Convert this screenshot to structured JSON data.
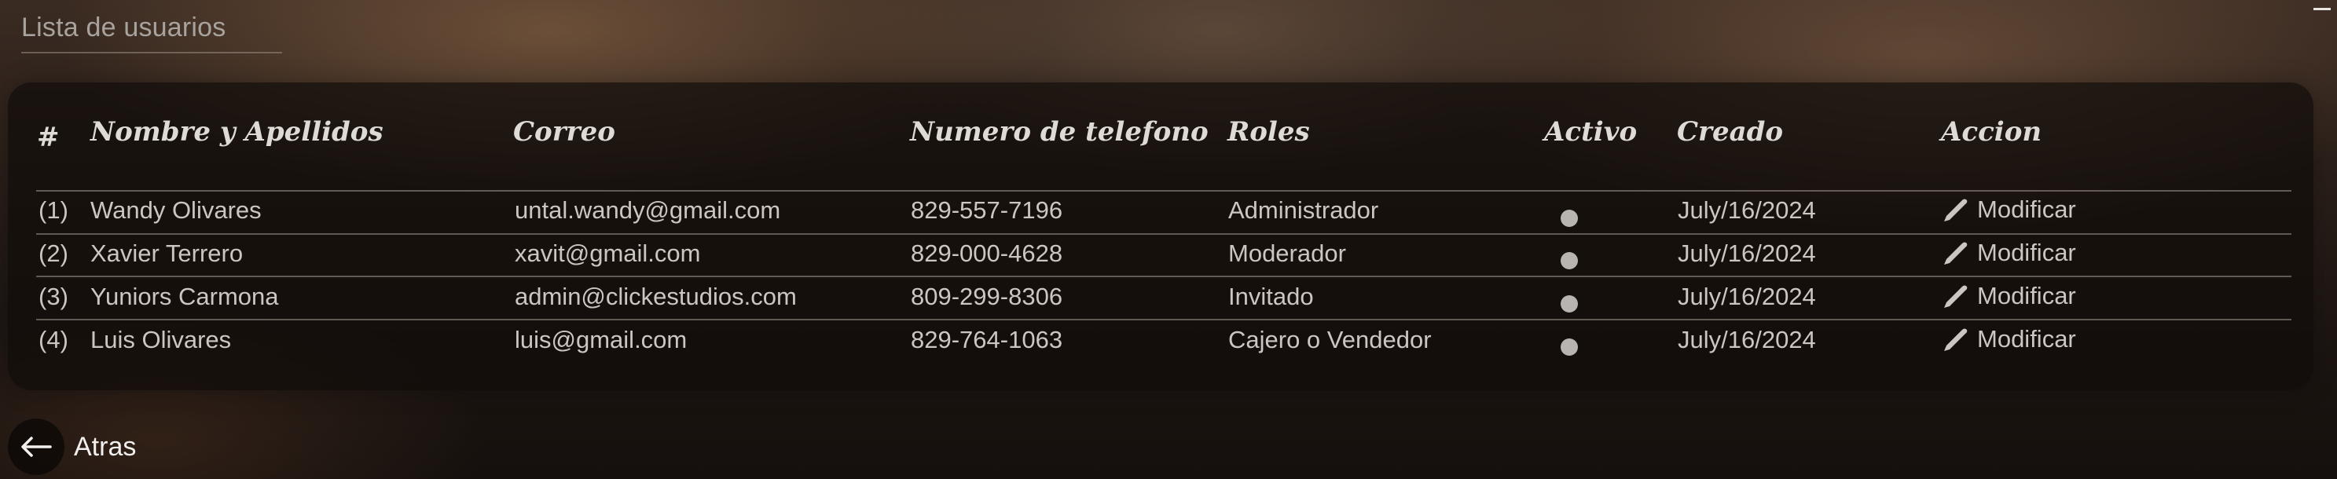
{
  "page": {
    "title": "Lista de usuarios"
  },
  "table": {
    "headers": {
      "index": "#",
      "name": "Nombre y Apellidos",
      "email": "Correo",
      "phone": "Numero de telefono",
      "roles": "Roles",
      "active": "Activo",
      "created": "Creado",
      "action": "Accion"
    },
    "rows": [
      {
        "index": "(1)",
        "name": "Wandy Olivares",
        "email": "untal.wandy@gmail.com",
        "phone": "829-557-7196",
        "role": "Administrador",
        "active": true,
        "created": "July/16/2024",
        "action": "Modificar"
      },
      {
        "index": "(2)",
        "name": "Xavier Terrero",
        "email": "xavit@gmail.com",
        "phone": "829-000-4628",
        "role": "Moderador",
        "active": true,
        "created": "July/16/2024",
        "action": "Modificar"
      },
      {
        "index": "(3)",
        "name": "Yuniors Carmona",
        "email": "admin@clickestudios.com",
        "phone": "809-299-8306",
        "role": "Invitado",
        "active": true,
        "created": "July/16/2024",
        "action": "Modificar"
      },
      {
        "index": "(4)",
        "name": "Luis Olivares",
        "email": "luis@gmail.com",
        "phone": "829-764-1063",
        "role": "Cajero o Vendedor",
        "active": true,
        "created": "July/16/2024",
        "action": "Modificar"
      }
    ]
  },
  "footer": {
    "back_label": "Atras",
    "back_icon": "arrow-left-icon"
  },
  "icons": {
    "action": "pencil-icon",
    "active": "status-dot"
  },
  "colors": {
    "panel": "#100c0a",
    "text": "#cbc6c1",
    "header_text": "#dedad6"
  }
}
